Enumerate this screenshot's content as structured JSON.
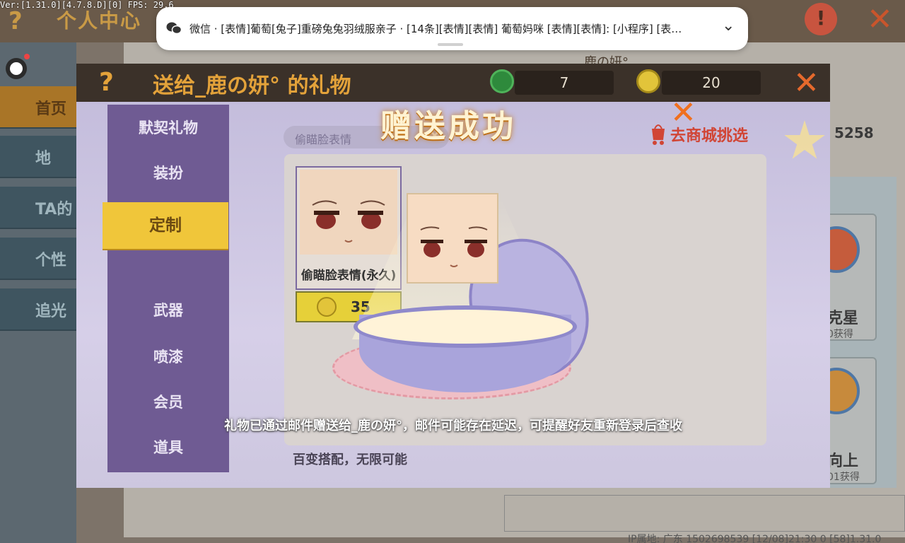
{
  "debug": {
    "fps_line": "Ver:[1.31.0][4.7.8.D][0] FPS: 29.6"
  },
  "background": {
    "title": "个人中心",
    "help": "?",
    "sidebar": [
      "首页",
      "地",
      "TA的",
      "个性",
      "追光"
    ],
    "profile_name": "鹿の妍°",
    "count": "5258",
    "cards": [
      {
        "title": "克星",
        "sub": "0获得"
      },
      {
        "title": "向上",
        "sub": "01获得"
      }
    ],
    "footer": "IP属地: 广东      1502698539      [12/08]21:30 0  [58]1.31.0"
  },
  "notification": {
    "app": "微信",
    "text": "微信 · [表情]葡萄[兔子]重磅兔兔羽绒服亲子 · [14条][表情][表情] 葡萄妈咪 [表情][表情]: [小程序] [表…"
  },
  "dialog": {
    "help": "?",
    "title": "送给_鹿の妍° 的礼物",
    "gems": "7",
    "coins": "20",
    "tabs": [
      "默契礼物",
      "装扮",
      "定制",
      "武器",
      "喷漆",
      "会员",
      "道具"
    ],
    "active_tab": "定制",
    "search_text": "偷瞄脸表情",
    "shop_link": "去商城挑选",
    "item": {
      "label": "偷瞄脸表情(永久)",
      "price": "35"
    },
    "success_title": "赠送成功",
    "notice": "礼物已通过邮件赠送给_鹿の妍°，邮件可能存在延迟，可提醒好友重新登录后查收",
    "subtext": "百变搭配，无限可能"
  },
  "colors": {
    "accent": "#e3a23a",
    "active_tab": "#f0c63a",
    "close": "#e5692c"
  }
}
